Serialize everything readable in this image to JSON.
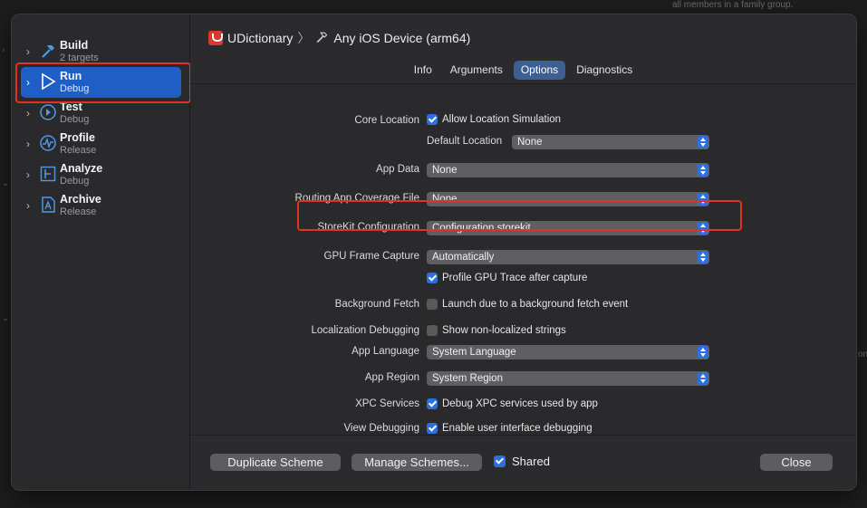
{
  "background": {
    "hint_text": "all members in a family group.",
    "right_edge_text": "on"
  },
  "sidebar": {
    "items": [
      {
        "name": "Build",
        "sub": "2 targets",
        "icon": "hammer-icon"
      },
      {
        "name": "Run",
        "sub": "Debug",
        "icon": "play-icon"
      },
      {
        "name": "Test",
        "sub": "Debug",
        "icon": "test-diamond-icon"
      },
      {
        "name": "Profile",
        "sub": "Release",
        "icon": "instruments-gauge-icon"
      },
      {
        "name": "Analyze",
        "sub": "Debug",
        "icon": "analyze-chart-icon"
      },
      {
        "name": "Archive",
        "sub": "Release",
        "icon": "archive-pen-icon"
      }
    ],
    "selected_index": 1
  },
  "header": {
    "scheme": "UDictionary",
    "separator": "〉",
    "destination": "Any iOS Device (arm64)"
  },
  "tabs": [
    {
      "label": "Info"
    },
    {
      "label": "Arguments"
    },
    {
      "label": "Options"
    },
    {
      "label": "Diagnostics"
    }
  ],
  "active_tab": "Options",
  "options": {
    "core_location": {
      "label": "Core Location",
      "check_label": "Allow Location Simulation",
      "checked": true,
      "default_location_label": "Default Location",
      "default_location_value": "None"
    },
    "app_data": {
      "label": "App Data",
      "value": "None"
    },
    "routing": {
      "label": "Routing App Coverage File",
      "value": "None"
    },
    "storekit": {
      "label": "StoreKit Configuration",
      "value": "Configuration.storekit"
    },
    "gpu_frame": {
      "label": "GPU Frame Capture",
      "value": "Automatically",
      "check_label": "Profile GPU Trace after capture",
      "checked": true
    },
    "background_fetch": {
      "label": "Background Fetch",
      "check_label": "Launch due to a background fetch event",
      "checked": false
    },
    "localization": {
      "label": "Localization Debugging",
      "check_label": "Show non-localized strings",
      "checked": false
    },
    "app_language": {
      "label": "App Language",
      "value": "System Language"
    },
    "app_region": {
      "label": "App Region",
      "value": "System Region"
    },
    "xpc": {
      "label": "XPC Services",
      "check_label": "Debug XPC services used by app",
      "checked": true
    },
    "view_debugging": {
      "label": "View Debugging",
      "check_label": "Enable user interface debugging",
      "checked": true
    }
  },
  "footer": {
    "duplicate_label": "Duplicate Scheme",
    "manage_label": "Manage Schemes...",
    "shared_label": "Shared",
    "shared_checked": true,
    "close_label": "Close"
  },
  "colors": {
    "accent": "#2d6fe0",
    "selection": "#1f5fc5",
    "highlight_box": "#e3321f"
  }
}
